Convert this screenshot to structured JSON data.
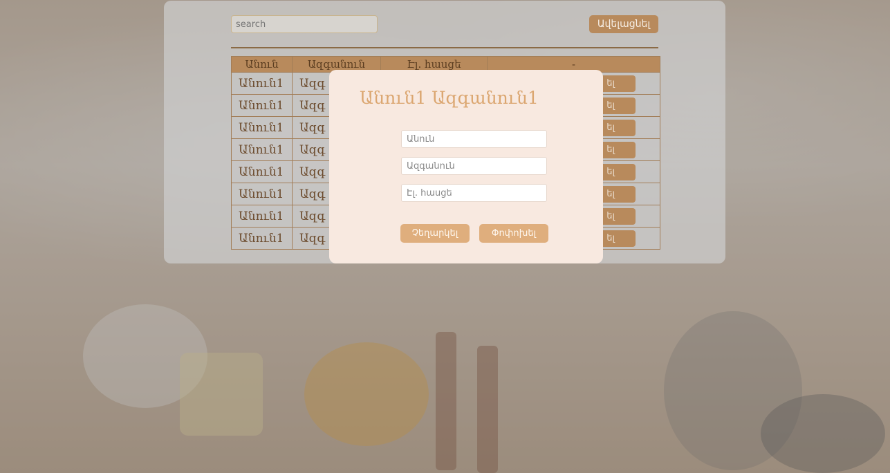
{
  "toolbar": {
    "search_placeholder": "search",
    "add_label": "Ավելացնել"
  },
  "table": {
    "headers": [
      "Անուն",
      "Ազգանուն",
      "Էլ. հասցե",
      "-"
    ],
    "rows": [
      {
        "name": "Անուն1",
        "surname": "Ազգ",
        "action": "ել"
      },
      {
        "name": "Անուն1",
        "surname": "Ազգ",
        "action": "ել"
      },
      {
        "name": "Անուն1",
        "surname": "Ազգ",
        "action": "ել"
      },
      {
        "name": "Անուն1",
        "surname": "Ազգ",
        "action": "ել"
      },
      {
        "name": "Անուն1",
        "surname": "Ազգ",
        "action": "ել"
      },
      {
        "name": "Անուն1",
        "surname": "Ազգ",
        "action": "ել"
      },
      {
        "name": "Անուն1",
        "surname": "Ազգ",
        "action": "ել"
      },
      {
        "name": "Անուն1",
        "surname": "Ազգ",
        "action": "ել"
      }
    ]
  },
  "modal": {
    "title": "Անուն1 Ազգանուն1",
    "fields": [
      {
        "placeholder": "Անուն",
        "value": ""
      },
      {
        "placeholder": "Ազգանուն",
        "value": ""
      },
      {
        "placeholder": "Էլ. հասցե",
        "value": ""
      }
    ],
    "cancel_label": "Չեղարկել",
    "change_label": "Փոփոխել"
  },
  "colors": {
    "accent": "#dfae7d",
    "accent_dark": "#b88a5c",
    "modal_bg": "#f8e9e0",
    "title": "#dba670"
  }
}
